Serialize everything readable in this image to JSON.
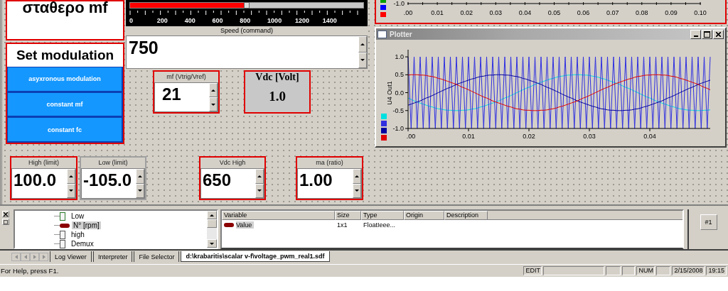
{
  "title_box": {
    "text": "σταθερο mf",
    "selected": true
  },
  "modulation_panel": {
    "title": "Set modulation",
    "selected": true,
    "buttons": [
      "asyxronous modulation",
      "constant mf",
      "constant fc"
    ]
  },
  "speed_slider": {
    "level": 0.5,
    "ticks": [
      "0",
      "200",
      "400",
      "600",
      "800",
      "1000",
      "1200",
      "1400"
    ]
  },
  "speed_input": {
    "label": "Speed (command)",
    "value": "750"
  },
  "middle_instruments": [
    {
      "kind": "spin",
      "label": "mf (Vtrig/Vref)",
      "value": "21",
      "selected": true
    },
    {
      "kind": "display",
      "label": "Vdc [Volt]",
      "value": "1.0",
      "selected": true
    }
  ],
  "bottom_instruments": [
    {
      "kind": "spin",
      "label": "High (limit)",
      "value": "100.0",
      "selected": true
    },
    {
      "kind": "spin",
      "label": "Low (limit)",
      "value": "-105.0",
      "selected": false
    },
    {
      "kind": "spin",
      "label": "Vdc High",
      "value": "650",
      "selected": true
    },
    {
      "kind": "spin",
      "label": "ma (ratio)",
      "value": "1.00",
      "selected": true
    }
  ],
  "top_chart": {
    "selected": true,
    "axis_end_label": "-1.0",
    "axis_labels": [
      ".00",
      "0.01",
      "0.02",
      "0.03",
      "0.04",
      "0.05",
      "0.06",
      "0.07",
      "0.08",
      "0.09",
      "0.10"
    ],
    "legend": [
      {
        "color": "#00a000"
      },
      {
        "color": "#0000ff"
      },
      {
        "color": "#ff0000"
      }
    ]
  },
  "plotter": {
    "title": "Plotter",
    "chart_data": {
      "type": "line",
      "ylabel": "U4 Out1",
      "xlim": [
        0,
        0.05
      ],
      "ylim": [
        -1,
        1.2
      ],
      "xticks": [
        {
          "value": 0,
          "label": ".00"
        },
        {
          "value": 0.01,
          "label": "0.01"
        },
        {
          "value": 0.02,
          "label": "0.02"
        },
        {
          "value": 0.03,
          "label": "0.03"
        },
        {
          "value": 0.04,
          "label": "0.04"
        }
      ],
      "yticks": [
        {
          "value": -1,
          "label": "-1.0"
        },
        {
          "value": -0.5,
          "label": "-0.5"
        },
        {
          "value": 0,
          "label": "0.0"
        },
        {
          "value": 0.5,
          "label": "0.5"
        },
        {
          "value": 1,
          "label": "1.0"
        }
      ],
      "x": [
        0,
        0.0005,
        0.001,
        0.0015,
        0.002,
        0.0025,
        0.003,
        0.0035,
        0.004,
        0.0045,
        0.005,
        0.0055,
        0.006,
        0.0065,
        0.007,
        0.0075,
        0.008,
        0.0085,
        0.009,
        0.0095,
        0.01,
        0.0105,
        0.011,
        0.0115,
        0.012,
        0.0125,
        0.013,
        0.0135,
        0.014,
        0.0145,
        0.015,
        0.0155,
        0.016,
        0.0165,
        0.017,
        0.0175,
        0.018,
        0.0185,
        0.019,
        0.0195,
        0.02,
        0.0205,
        0.021,
        0.0215,
        0.022,
        0.0225,
        0.023,
        0.0235,
        0.024,
        0.0245,
        0.025,
        0.0255,
        0.026,
        0.0265,
        0.027,
        0.0275,
        0.028,
        0.0285,
        0.029,
        0.0295,
        0.03,
        0.0305,
        0.031,
        0.0315,
        0.032,
        0.0325,
        0.033,
        0.0335,
        0.034,
        0.0345,
        0.035,
        0.0355,
        0.036,
        0.0365,
        0.037,
        0.0375,
        0.038,
        0.0385,
        0.039,
        0.0395,
        0.04,
        0.0405,
        0.041,
        0.0415,
        0.042,
        0.0425,
        0.043,
        0.0435,
        0.044,
        0.0445,
        0.045,
        0.0455,
        0.046,
        0.0465,
        0.047,
        0.0475,
        0.048,
        0.0485,
        0.049,
        0.0495,
        0.05
      ],
      "series": [
        {
          "color": "#00e0e0",
          "values": [
            -0.15,
            -0.19,
            -0.23,
            -0.26,
            -0.29,
            -0.32,
            -0.35,
            -0.38,
            -0.4,
            -0.43,
            -0.45,
            -0.46,
            -0.48,
            -0.49,
            -0.49,
            -0.5,
            -0.5,
            -0.5,
            -0.49,
            -0.49,
            -0.48,
            -0.46,
            -0.45,
            -0.43,
            -0.4,
            -0.38,
            -0.35,
            -0.32,
            -0.29,
            -0.26,
            -0.23,
            -0.19,
            -0.15,
            -0.12,
            -0.08,
            -0.04,
            0,
            0.04,
            0.08,
            0.12,
            0.15,
            0.19,
            0.23,
            0.26,
            0.29,
            0.32,
            0.35,
            0.38,
            0.4,
            0.43,
            0.45,
            0.46,
            0.48,
            0.49,
            0.49,
            0.5,
            0.5,
            0.5,
            0.49,
            0.49,
            0.48,
            0.46,
            0.45,
            0.43,
            0.4,
            0.38,
            0.35,
            0.32,
            0.29,
            0.26,
            0.23,
            0.19,
            0.15,
            0.12,
            0.08,
            0.04,
            0,
            -0.04,
            -0.08,
            -0.12,
            -0.15,
            -0.19,
            -0.23,
            -0.26,
            -0.29,
            -0.32,
            -0.35,
            -0.38,
            -0.4,
            -0.43,
            -0.45,
            -0.46,
            -0.48,
            -0.49,
            -0.49,
            -0.5,
            -0.5,
            -0.5,
            -0.49,
            -0.49,
            -0.48
          ]
        },
        {
          "color": "#3030e0",
          "values": [
            1,
            -1,
            1,
            -1,
            1,
            -1,
            1,
            -1,
            1,
            -1,
            1,
            -1,
            1,
            -1,
            1,
            -1,
            1,
            -1,
            1,
            -1,
            1,
            -1,
            1,
            -1,
            1,
            -1,
            1,
            -1,
            1,
            -1,
            1,
            -1,
            1,
            -1,
            1,
            -1,
            1,
            -1,
            1,
            -1,
            1,
            -1,
            1,
            -1,
            1,
            -1,
            1,
            -1,
            1,
            -1,
            1,
            -1,
            1,
            -1,
            1,
            -1,
            1,
            -1,
            1,
            -1,
            1,
            -1,
            1,
            -1,
            1,
            -1,
            1,
            -1,
            1,
            -1,
            1,
            -1,
            1,
            -1,
            1,
            -1,
            1,
            -1,
            1,
            -1,
            1,
            -1,
            1,
            -1,
            1,
            -1,
            1,
            -1,
            1,
            -1,
            1,
            -1,
            1,
            -1,
            1,
            -1,
            1,
            -1,
            1,
            -1,
            1
          ]
        },
        {
          "color": "#0000a0",
          "values": [
            -0.35,
            -0.32,
            -0.29,
            -0.26,
            -0.23,
            -0.19,
            -0.15,
            -0.12,
            -0.08,
            -0.04,
            0,
            0.04,
            0.08,
            0.12,
            0.15,
            0.19,
            0.23,
            0.26,
            0.29,
            0.32,
            0.35,
            0.38,
            0.4,
            0.43,
            0.45,
            0.46,
            0.48,
            0.49,
            0.49,
            0.5,
            0.5,
            0.5,
            0.49,
            0.49,
            0.48,
            0.46,
            0.45,
            0.43,
            0.4,
            0.38,
            0.35,
            0.32,
            0.29,
            0.26,
            0.23,
            0.19,
            0.15,
            0.12,
            0.08,
            0.04,
            0,
            -0.04,
            -0.08,
            -0.12,
            -0.15,
            -0.19,
            -0.23,
            -0.26,
            -0.29,
            -0.32,
            -0.35,
            -0.38,
            -0.4,
            -0.43,
            -0.45,
            -0.46,
            -0.48,
            -0.49,
            -0.49,
            -0.5,
            -0.5,
            -0.5,
            -0.49,
            -0.49,
            -0.48,
            -0.46,
            -0.45,
            -0.43,
            -0.4,
            -0.38,
            -0.35,
            -0.32,
            -0.29,
            -0.26,
            -0.23,
            -0.19,
            -0.15,
            -0.12,
            -0.08,
            -0.04,
            0,
            0.04,
            0.08,
            0.12,
            0.15,
            0.19,
            0.23,
            0.26,
            0.29,
            0.32,
            0.35
          ]
        },
        {
          "color": "#e00000",
          "values": [
            0.49,
            0.5,
            0.5,
            0.5,
            0.49,
            0.49,
            0.48,
            0.46,
            0.45,
            0.43,
            0.4,
            0.38,
            0.35,
            0.32,
            0.29,
            0.26,
            0.23,
            0.19,
            0.15,
            0.12,
            0.08,
            0.04,
            0,
            -0.04,
            -0.08,
            -0.12,
            -0.15,
            -0.19,
            -0.23,
            -0.26,
            -0.29,
            -0.32,
            -0.35,
            -0.38,
            -0.4,
            -0.43,
            -0.45,
            -0.46,
            -0.48,
            -0.49,
            -0.49,
            -0.5,
            -0.5,
            -0.5,
            -0.49,
            -0.49,
            -0.48,
            -0.46,
            -0.45,
            -0.43,
            -0.4,
            -0.38,
            -0.35,
            -0.32,
            -0.29,
            -0.26,
            -0.23,
            -0.19,
            -0.15,
            -0.12,
            -0.08,
            -0.04,
            0,
            0.04,
            0.08,
            0.12,
            0.15,
            0.19,
            0.23,
            0.26,
            0.29,
            0.32,
            0.35,
            0.38,
            0.4,
            0.43,
            0.45,
            0.46,
            0.48,
            0.49,
            0.49,
            0.5,
            0.5,
            0.5,
            0.49,
            0.49,
            0.48,
            0.46,
            0.45,
            0.43,
            0.4,
            0.38,
            0.35,
            0.32,
            0.29,
            0.26,
            0.23,
            0.19,
            0.15,
            0.12,
            0.08
          ]
        }
      ]
    }
  },
  "tree": [
    {
      "label": "Low",
      "kind": "block",
      "selected": false
    },
    {
      "label": "N° [rpm]",
      "kind": "variable",
      "selected": true
    },
    {
      "label": "high",
      "kind": "block",
      "selected": false
    },
    {
      "label": "Demux",
      "kind": "block",
      "selected": false
    }
  ],
  "variable_table": {
    "columns": [
      "Variable",
      "Size",
      "Type",
      "Origin",
      "Description"
    ],
    "rows": [
      {
        "cells": [
          "Value",
          "1x1",
          "FloatIeee..."
        ],
        "selected": true
      }
    ]
  },
  "layout_button": "#1",
  "tabs": [
    {
      "label": "Log Viewer",
      "selected": false
    },
    {
      "label": "Interpreter",
      "selected": false
    },
    {
      "label": "File Selector",
      "selected": false
    },
    {
      "label": "d:\\krabaritis\\scalar v-f\\voltage_pwm_real1.sdf",
      "selected": true
    }
  ],
  "status_bar": {
    "help": "For Help, press F1.",
    "panes": [
      "EDIT",
      "NUM",
      "2/15/2008",
      "19:15"
    ]
  }
}
